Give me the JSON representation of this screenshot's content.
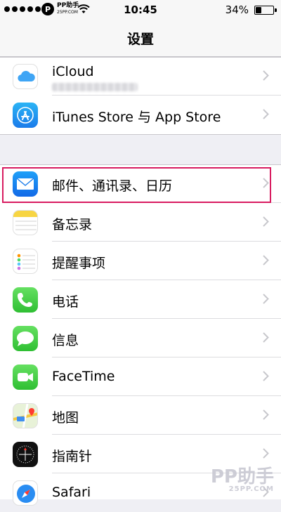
{
  "status_bar": {
    "carrier_name": "PP助手",
    "carrier_sub": "25PP.COM",
    "time": "10:45",
    "battery_percent": "34%",
    "battery_level": 0.34
  },
  "nav": {
    "title": "设置"
  },
  "group1": [
    {
      "label": "iCloud",
      "icon": "icloud-icon"
    },
    {
      "label": "iTunes Store 与 App Store",
      "icon": "app-store-icon"
    }
  ],
  "group2": [
    {
      "label": "邮件、通讯录、日历",
      "icon": "mail-icon",
      "highlighted": true
    },
    {
      "label": "备忘录",
      "icon": "notes-icon"
    },
    {
      "label": "提醒事项",
      "icon": "reminders-icon"
    },
    {
      "label": "电话",
      "icon": "phone-icon"
    },
    {
      "label": "信息",
      "icon": "messages-icon"
    },
    {
      "label": "FaceTime",
      "icon": "facetime-icon"
    },
    {
      "label": "地图",
      "icon": "maps-icon"
    },
    {
      "label": "指南针",
      "icon": "compass-icon"
    },
    {
      "label": "Safari",
      "icon": "safari-icon"
    }
  ],
  "watermark": {
    "main": "PP助手",
    "sub": "25PP.COM"
  },
  "colors": {
    "highlight": "#d81b60",
    "chevron": "#c7c7cc",
    "background": "#efeff4"
  }
}
